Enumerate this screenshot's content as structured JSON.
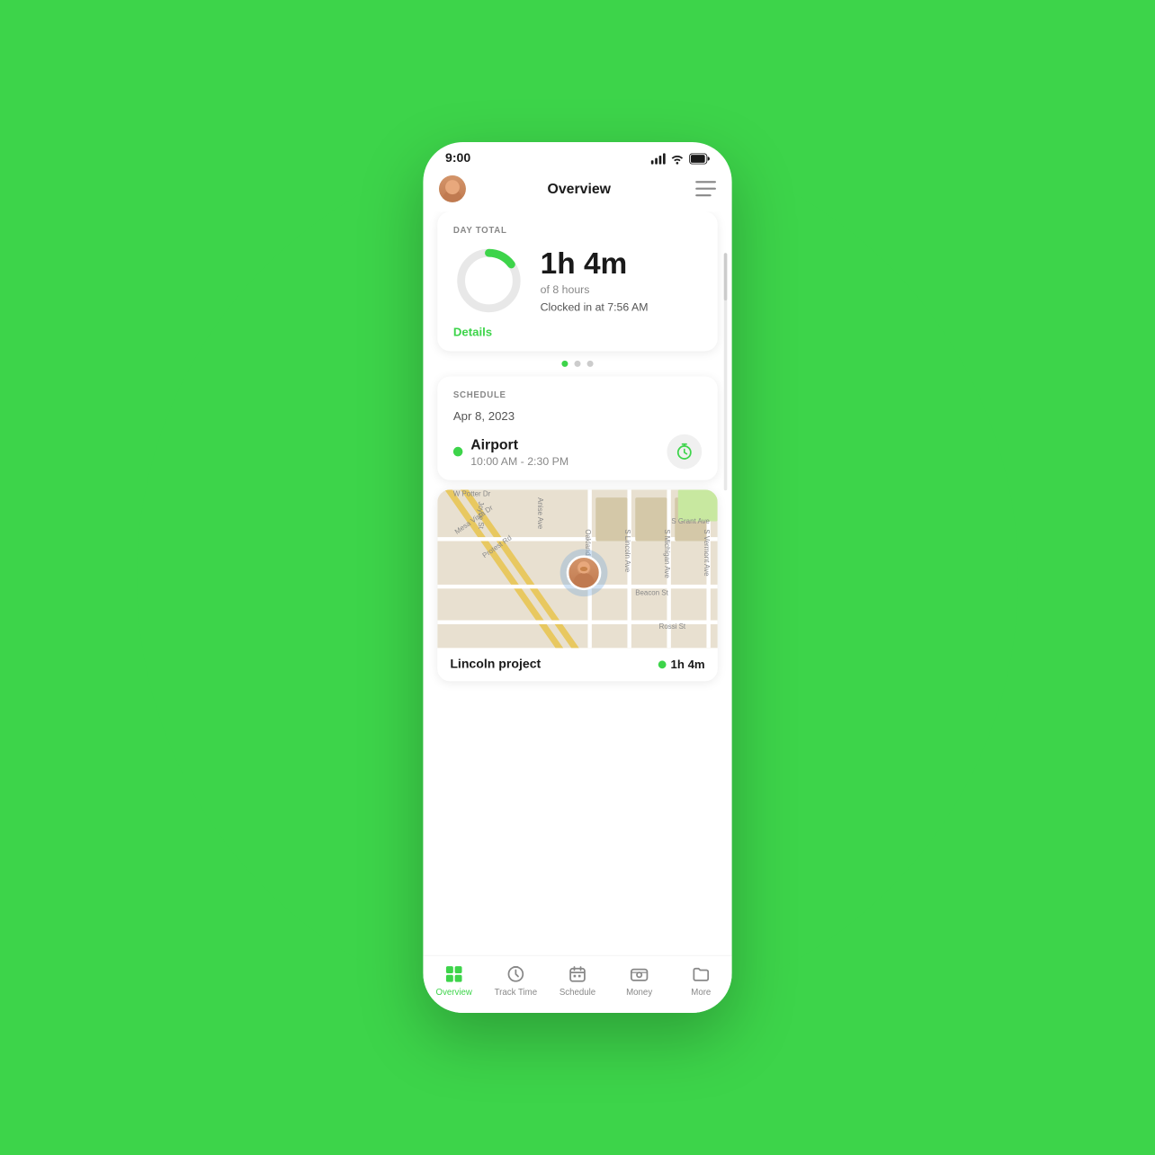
{
  "background": {
    "circle_color": "#3dd44a"
  },
  "status_bar": {
    "time": "9:00",
    "signal": "signal",
    "wifi": "wifi",
    "battery": "battery"
  },
  "header": {
    "title": "Overview",
    "menu_label": "menu"
  },
  "day_total": {
    "section_label": "DAY TOTAL",
    "time_display": "1h 4m",
    "time_sub": "of 8 hours",
    "clocked_in": "Clocked in at 7:56 AM",
    "details_label": "Details",
    "progress_percent": 13
  },
  "pagination": {
    "dots": [
      "active",
      "inactive",
      "inactive"
    ]
  },
  "schedule": {
    "section_label": "SCHEDULE",
    "date": "Apr 8, 2023",
    "item_title": "Airport",
    "item_time": "10:00 AM - 2:30 PM"
  },
  "map": {
    "project_name": "Lincoln project",
    "project_time": "1h 4m"
  },
  "nav": {
    "items": [
      {
        "label": "Overview",
        "active": true,
        "icon": "grid-icon"
      },
      {
        "label": "Track Time",
        "active": false,
        "icon": "clock-icon"
      },
      {
        "label": "Schedule",
        "active": false,
        "icon": "calendar-icon"
      },
      {
        "label": "Money",
        "active": false,
        "icon": "money-icon"
      },
      {
        "label": "More",
        "active": false,
        "icon": "folder-icon"
      }
    ]
  }
}
